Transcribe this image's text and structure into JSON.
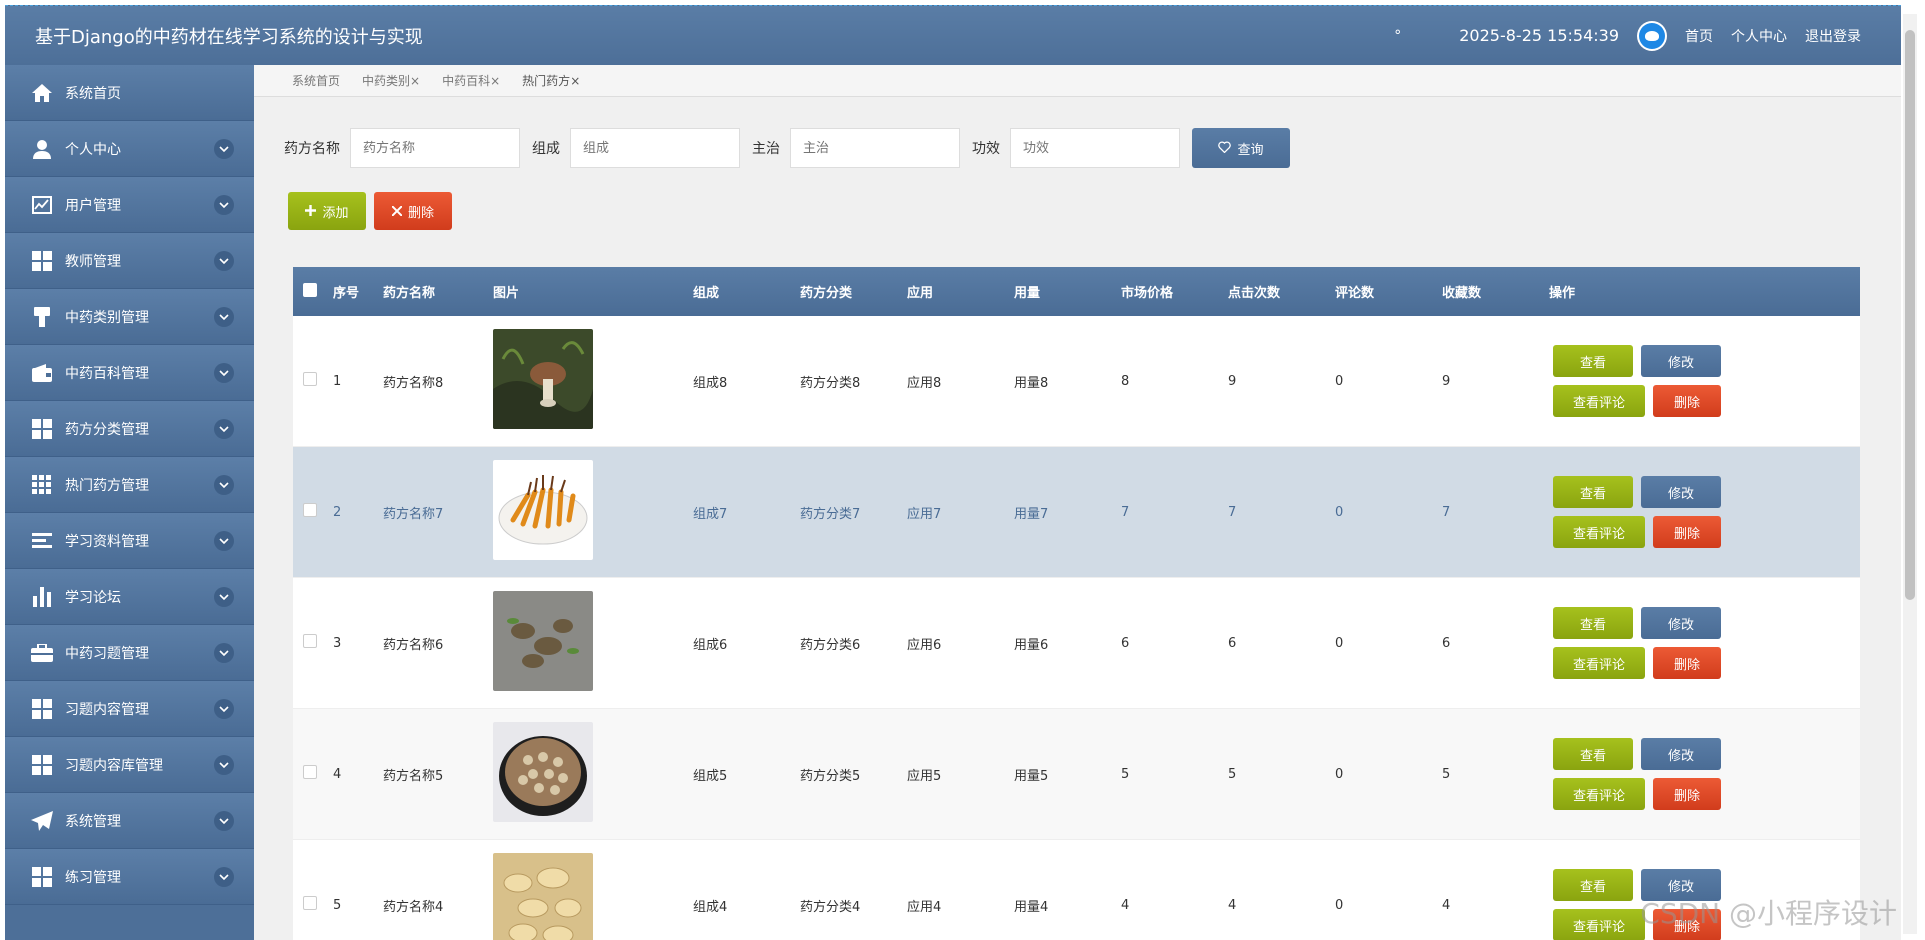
{
  "header": {
    "title": "基于Django的中药材在线学习系统的设计与实现",
    "degree": "°",
    "clock": "2025-8-25 15:54:39",
    "links": [
      "首页",
      "个人中心",
      "退出登录"
    ]
  },
  "sidebar": {
    "items": [
      {
        "label": "系统首页",
        "icon": "home-icon",
        "chevron": false
      },
      {
        "label": "个人中心",
        "icon": "user-icon",
        "chevron": true
      },
      {
        "label": "用户管理",
        "icon": "chart-line-icon",
        "chevron": true
      },
      {
        "label": "教师管理",
        "icon": "grid-icon",
        "chevron": true
      },
      {
        "label": "中药类别管理",
        "icon": "brush-icon",
        "chevron": true
      },
      {
        "label": "中药百科管理",
        "icon": "wallet-icon",
        "chevron": true
      },
      {
        "label": "药方分类管理",
        "icon": "grid-icon",
        "chevron": true
      },
      {
        "label": "热门药方管理",
        "icon": "apps-icon",
        "chevron": true
      },
      {
        "label": "学习资料管理",
        "icon": "list-icon",
        "chevron": true
      },
      {
        "label": "学习论坛",
        "icon": "bar-chart-icon",
        "chevron": true
      },
      {
        "label": "中药习题管理",
        "icon": "briefcase-icon",
        "chevron": true
      },
      {
        "label": "习题内容管理",
        "icon": "grid-icon",
        "chevron": true
      },
      {
        "label": "习题内容库管理",
        "icon": "grid-icon",
        "chevron": true
      },
      {
        "label": "系统管理",
        "icon": "paper-plane-icon",
        "chevron": true
      },
      {
        "label": "练习管理",
        "icon": "grid-icon",
        "chevron": true
      }
    ]
  },
  "tabs": [
    {
      "label": "系统首页",
      "close": ""
    },
    {
      "label": "中药类别",
      "close": "×"
    },
    {
      "label": "中药百科",
      "close": "×"
    },
    {
      "label": "热门药方",
      "close": "×"
    }
  ],
  "search": {
    "fields": [
      {
        "label": "药方名称",
        "placeholder": "药方名称"
      },
      {
        "label": "组成",
        "placeholder": "组成"
      },
      {
        "label": "主治",
        "placeholder": "主治"
      },
      {
        "label": "功效",
        "placeholder": "功效"
      }
    ],
    "query_label": "查询"
  },
  "actions": {
    "add": "添加",
    "delete": "删除"
  },
  "table": {
    "headers": [
      "序号",
      "药方名称",
      "图片",
      "组成",
      "药方分类",
      "应用",
      "用量",
      "市场价格",
      "点击次数",
      "评论数",
      "收藏数",
      "操作"
    ],
    "ops": {
      "view": "查看",
      "edit": "修改",
      "comments": "查看评论",
      "delete": "删除"
    },
    "rows": [
      {
        "idx": "1",
        "name": "药方名称8",
        "comp": "组成8",
        "cat": "药方分类8",
        "app": "应用8",
        "dose": "用量8",
        "price": "8",
        "clicks": "9",
        "comments": "0",
        "favs": "9",
        "image": "mushroom"
      },
      {
        "idx": "2",
        "name": "药方名称7",
        "comp": "组成7",
        "cat": "药方分类7",
        "app": "应用7",
        "dose": "用量7",
        "price": "7",
        "clicks": "7",
        "comments": "0",
        "favs": "7",
        "image": "cordyceps"
      },
      {
        "idx": "3",
        "name": "药方名称6",
        "comp": "组成6",
        "cat": "药方分类6",
        "app": "应用6",
        "dose": "用量6",
        "price": "6",
        "clicks": "6",
        "comments": "0",
        "favs": "6",
        "image": "roots"
      },
      {
        "idx": "4",
        "name": "药方名称5",
        "comp": "组成5",
        "cat": "药方分类5",
        "app": "应用5",
        "dose": "用量5",
        "price": "5",
        "clicks": "5",
        "comments": "0",
        "favs": "5",
        "image": "slices-bowl"
      },
      {
        "idx": "5",
        "name": "药方名称4",
        "comp": "组成4",
        "cat": "药方分类4",
        "app": "应用4",
        "dose": "用量4",
        "price": "4",
        "clicks": "4",
        "comments": "0",
        "favs": "4",
        "image": "dried-slices"
      }
    ]
  },
  "watermark": "CSDN @小程序设计",
  "colors": {
    "header": "#4d6f98",
    "green": "#9cb716",
    "red": "#e04a28",
    "highlight_row": "#d1dbe5"
  }
}
